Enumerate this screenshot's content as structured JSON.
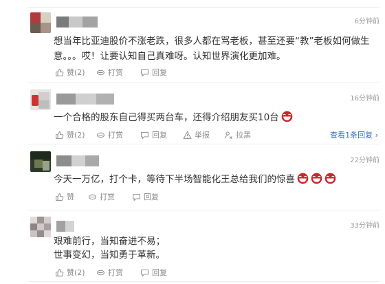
{
  "comments": [
    {
      "time": "6分钟前",
      "lines": [
        "想当年比亚迪股价不涨老跌，很多人都在骂老板，甚至还要“教”老板如何做生",
        "意。。。哎！让要认知自己真难呀。认知世界演化更加难。"
      ],
      "actions": {
        "like": "赞(2)",
        "tip": "打赏",
        "reply": "回复"
      }
    },
    {
      "time": "16分钟前",
      "lines": [
        "一个合格的股东自己得买两台车，还得介绍朋友买10台"
      ],
      "emoji_count": 1,
      "actions": {
        "like": "赞(2)",
        "tip": "打赏",
        "reply": "回复",
        "report": "举报",
        "block": "拉黑"
      },
      "view_replies": "查看1条回复 ›"
    },
    {
      "time": "22分钟前",
      "lines": [
        "今天一万亿，打个卡，等待下半场智能化王总给我们的惊喜"
      ],
      "emoji_count": 3,
      "actions": {
        "like": "赞",
        "tip": "打赏",
        "reply": "回复"
      }
    },
    {
      "time": "33分钟前",
      "lines": [
        "艰难前行，当知奋进不易；",
        "世事变幻，当知勇于革新。"
      ],
      "actions": {
        "like": "赞(2)",
        "tip": "打赏",
        "reply": "回复"
      }
    }
  ],
  "icons": {
    "like": "thumbs-up-icon",
    "tip": "tip-icon",
    "reply": "reply-icon",
    "report": "warning-icon",
    "block": "block-icon",
    "emoji": "laughing-emoji-icon"
  },
  "colors": {
    "link": "#3b6fb6",
    "muted": "#999999",
    "text": "#333333"
  }
}
